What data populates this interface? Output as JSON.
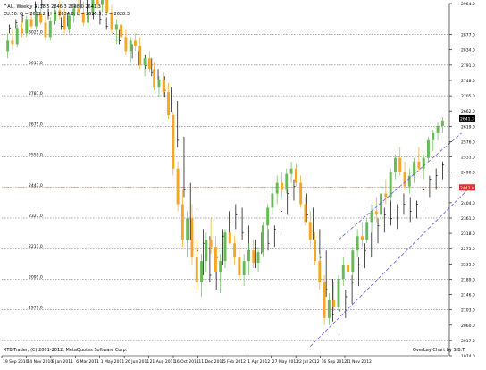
{
  "header": {
    "line1": "^AU, Weekly  3138.5 2846.3 2638.0 2641.3",
    "line2": "EU.50: O = 2632.2, H = 2634.8, L = 2625.3, C = 2628.3"
  },
  "footer": {
    "copyright": "XTB-Trader, (C) 2001-2012, MetaQuotes Software Corp.",
    "credit": "OverLay Chart by S.B.T."
  },
  "colors": {
    "background": "#ffffff",
    "bull_candle": "#66bb55",
    "bear_candle": "#f5a623",
    "overlay_bar": "#000000",
    "grid": "#555555",
    "trendline": "#4b4bd9",
    "current_price_marker": "#000000",
    "price_marker_red": "#e03030",
    "red_dotted_line": "#e06060"
  },
  "chart_data": {
    "type": "candlestick",
    "timeframe": "Weekly",
    "main_series": "^AU",
    "overlay_series": "EU.50",
    "right_axis_ticks": [
      "2964.0",
      "2877.0",
      "2834.0",
      "2791.0",
      "2748.0",
      "2705.0",
      "2662.0",
      "2619.0",
      "2576.0",
      "2533.0",
      "2490.0",
      "2447.0",
      "2404.0",
      "2361.0",
      "2318.0",
      "2275.0",
      "2232.0",
      "2189.0",
      "2146.0",
      "2103.0",
      "2060.0",
      "2017.0",
      "1974.0"
    ],
    "left_overlay_labels": [
      "3025.0",
      "2913.0",
      "2787.0",
      "2675.0",
      "2559.0",
      "2443.0",
      "2327.0",
      "2211.0",
      "2095.0",
      "1979.0"
    ],
    "x_labels": [
      "19 Sep 2010",
      "14 Nov 2010",
      "9 Jan 2011",
      "6 Mar 2011",
      "1 May 2011",
      "26 Jun 2011",
      "21 Aug 2011",
      "16 Oct 2011",
      "11 Dec 2011",
      "5 Feb 2012",
      "1 Apr 2012",
      "27 May 2012",
      "22 Jul 2012",
      "16 Sep 2012",
      "11 Nov 2012"
    ],
    "current_price": "2641.3",
    "red_price_marker": "2447.0",
    "ohlc": [
      {
        "o": 2830,
        "h": 2880,
        "l": 2810,
        "c": 2860
      },
      {
        "o": 2860,
        "h": 2890,
        "l": 2835,
        "c": 2850
      },
      {
        "o": 2850,
        "h": 2905,
        "l": 2840,
        "c": 2895
      },
      {
        "o": 2895,
        "h": 2915,
        "l": 2870,
        "c": 2880
      },
      {
        "o": 2880,
        "h": 2930,
        "l": 2870,
        "c": 2920
      },
      {
        "o": 2920,
        "h": 2940,
        "l": 2895,
        "c": 2900
      },
      {
        "o": 2900,
        "h": 2945,
        "l": 2890,
        "c": 2935
      },
      {
        "o": 2935,
        "h": 2950,
        "l": 2905,
        "c": 2910
      },
      {
        "o": 2910,
        "h": 2930,
        "l": 2860,
        "c": 2870
      },
      {
        "o": 2870,
        "h": 2925,
        "l": 2860,
        "c": 2915
      },
      {
        "o": 2915,
        "h": 2955,
        "l": 2905,
        "c": 2945
      },
      {
        "o": 2945,
        "h": 2970,
        "l": 2920,
        "c": 2930
      },
      {
        "o": 2930,
        "h": 2950,
        "l": 2880,
        "c": 2890
      },
      {
        "o": 2890,
        "h": 2940,
        "l": 2880,
        "c": 2930
      },
      {
        "o": 2930,
        "h": 2960,
        "l": 2910,
        "c": 2950
      },
      {
        "o": 2950,
        "h": 2980,
        "l": 2930,
        "c": 2940
      },
      {
        "o": 2940,
        "h": 2970,
        "l": 2900,
        "c": 2910
      },
      {
        "o": 2910,
        "h": 2950,
        "l": 2890,
        "c": 2940
      },
      {
        "o": 2940,
        "h": 2995,
        "l": 2930,
        "c": 2985
      },
      {
        "o": 2985,
        "h": 3000,
        "l": 2950,
        "c": 2960
      },
      {
        "o": 2960,
        "h": 2985,
        "l": 2940,
        "c": 2975
      },
      {
        "o": 2975,
        "h": 2990,
        "l": 2930,
        "c": 2940
      },
      {
        "o": 2940,
        "h": 2960,
        "l": 2880,
        "c": 2890
      },
      {
        "o": 2890,
        "h": 2920,
        "l": 2850,
        "c": 2905
      },
      {
        "o": 2905,
        "h": 2930,
        "l": 2860,
        "c": 2870
      },
      {
        "o": 2870,
        "h": 2890,
        "l": 2820,
        "c": 2830
      },
      {
        "o": 2830,
        "h": 2870,
        "l": 2800,
        "c": 2860
      },
      {
        "o": 2860,
        "h": 2880,
        "l": 2830,
        "c": 2845
      },
      {
        "o": 2845,
        "h": 2870,
        "l": 2780,
        "c": 2790
      },
      {
        "o": 2790,
        "h": 2820,
        "l": 2760,
        "c": 2810
      },
      {
        "o": 2810,
        "h": 2830,
        "l": 2770,
        "c": 2780
      },
      {
        "o": 2780,
        "h": 2800,
        "l": 2720,
        "c": 2730
      },
      {
        "o": 2730,
        "h": 2760,
        "l": 2700,
        "c": 2750
      },
      {
        "o": 2750,
        "h": 2770,
        "l": 2700,
        "c": 2715
      },
      {
        "o": 2715,
        "h": 2740,
        "l": 2640,
        "c": 2650
      },
      {
        "o": 2650,
        "h": 2660,
        "l": 2480,
        "c": 2500
      },
      {
        "o": 2500,
        "h": 2520,
        "l": 2380,
        "c": 2400
      },
      {
        "o": 2400,
        "h": 2440,
        "l": 2280,
        "c": 2300
      },
      {
        "o": 2300,
        "h": 2380,
        "l": 2250,
        "c": 2360
      },
      {
        "o": 2360,
        "h": 2400,
        "l": 2230,
        "c": 2250
      },
      {
        "o": 2250,
        "h": 2300,
        "l": 2160,
        "c": 2180
      },
      {
        "o": 2180,
        "h": 2260,
        "l": 2140,
        "c": 2240
      },
      {
        "o": 2240,
        "h": 2320,
        "l": 2210,
        "c": 2300
      },
      {
        "o": 2300,
        "h": 2360,
        "l": 2260,
        "c": 2280
      },
      {
        "o": 2280,
        "h": 2310,
        "l": 2190,
        "c": 2210
      },
      {
        "o": 2210,
        "h": 2260,
        "l": 2150,
        "c": 2240
      },
      {
        "o": 2240,
        "h": 2330,
        "l": 2220,
        "c": 2320
      },
      {
        "o": 2320,
        "h": 2360,
        "l": 2270,
        "c": 2290
      },
      {
        "o": 2290,
        "h": 2310,
        "l": 2230,
        "c": 2250
      },
      {
        "o": 2250,
        "h": 2280,
        "l": 2180,
        "c": 2200
      },
      {
        "o": 2200,
        "h": 2260,
        "l": 2170,
        "c": 2240
      },
      {
        "o": 2240,
        "h": 2290,
        "l": 2200,
        "c": 2270
      },
      {
        "o": 2270,
        "h": 2300,
        "l": 2220,
        "c": 2235
      },
      {
        "o": 2235,
        "h": 2280,
        "l": 2210,
        "c": 2265
      },
      {
        "o": 2265,
        "h": 2350,
        "l": 2250,
        "c": 2340
      },
      {
        "o": 2340,
        "h": 2400,
        "l": 2320,
        "c": 2390
      },
      {
        "o": 2390,
        "h": 2450,
        "l": 2370,
        "c": 2430
      },
      {
        "o": 2430,
        "h": 2480,
        "l": 2400,
        "c": 2460
      },
      {
        "o": 2460,
        "h": 2490,
        "l": 2420,
        "c": 2440
      },
      {
        "o": 2440,
        "h": 2500,
        "l": 2430,
        "c": 2485
      },
      {
        "o": 2485,
        "h": 2520,
        "l": 2460,
        "c": 2500
      },
      {
        "o": 2500,
        "h": 2515,
        "l": 2450,
        "c": 2460
      },
      {
        "o": 2460,
        "h": 2480,
        "l": 2390,
        "c": 2400
      },
      {
        "o": 2400,
        "h": 2420,
        "l": 2340,
        "c": 2350
      },
      {
        "o": 2350,
        "h": 2380,
        "l": 2280,
        "c": 2300
      },
      {
        "o": 2300,
        "h": 2320,
        "l": 2230,
        "c": 2240
      },
      {
        "o": 2240,
        "h": 2260,
        "l": 2160,
        "c": 2180
      },
      {
        "o": 2180,
        "h": 2200,
        "l": 2060,
        "c": 2080
      },
      {
        "o": 2080,
        "h": 2150,
        "l": 2060,
        "c": 2130
      },
      {
        "o": 2130,
        "h": 2180,
        "l": 2100,
        "c": 2110
      },
      {
        "o": 2110,
        "h": 2200,
        "l": 2100,
        "c": 2190
      },
      {
        "o": 2190,
        "h": 2250,
        "l": 2170,
        "c": 2230
      },
      {
        "o": 2230,
        "h": 2260,
        "l": 2190,
        "c": 2210
      },
      {
        "o": 2210,
        "h": 2280,
        "l": 2200,
        "c": 2270
      },
      {
        "o": 2270,
        "h": 2330,
        "l": 2250,
        "c": 2310
      },
      {
        "o": 2310,
        "h": 2350,
        "l": 2280,
        "c": 2300
      },
      {
        "o": 2300,
        "h": 2360,
        "l": 2290,
        "c": 2350
      },
      {
        "o": 2350,
        "h": 2400,
        "l": 2320,
        "c": 2380
      },
      {
        "o": 2380,
        "h": 2420,
        "l": 2350,
        "c": 2370
      },
      {
        "o": 2370,
        "h": 2440,
        "l": 2360,
        "c": 2430
      },
      {
        "o": 2430,
        "h": 2470,
        "l": 2400,
        "c": 2420
      },
      {
        "o": 2420,
        "h": 2500,
        "l": 2410,
        "c": 2490
      },
      {
        "o": 2490,
        "h": 2540,
        "l": 2470,
        "c": 2530
      },
      {
        "o": 2530,
        "h": 2560,
        "l": 2480,
        "c": 2490
      },
      {
        "o": 2490,
        "h": 2520,
        "l": 2440,
        "c": 2450
      },
      {
        "o": 2450,
        "h": 2500,
        "l": 2430,
        "c": 2480
      },
      {
        "o": 2480,
        "h": 2530,
        "l": 2460,
        "c": 2520
      },
      {
        "o": 2520,
        "h": 2560,
        "l": 2490,
        "c": 2500
      },
      {
        "o": 2500,
        "h": 2540,
        "l": 2470,
        "c": 2530
      },
      {
        "o": 2530,
        "h": 2590,
        "l": 2520,
        "c": 2580
      },
      {
        "o": 2580,
        "h": 2610,
        "l": 2550,
        "c": 2600
      },
      {
        "o": 2600,
        "h": 2630,
        "l": 2580,
        "c": 2620
      },
      {
        "o": 2620,
        "h": 2645,
        "l": 2600,
        "c": 2635
      }
    ],
    "overlay_bars": [
      {
        "h": 2905,
        "l": 2880,
        "c": 2895
      },
      {
        "h": 2920,
        "l": 2895,
        "c": 2910
      },
      {
        "h": 2935,
        "l": 2910,
        "c": 2930
      },
      {
        "h": 2960,
        "l": 2930,
        "c": 2950
      },
      {
        "h": 2970,
        "l": 2940,
        "c": 2955
      },
      {
        "h": 2975,
        "l": 2950,
        "c": 2960
      },
      {
        "h": 2950,
        "l": 2920,
        "c": 2930
      },
      {
        "h": 2940,
        "l": 2905,
        "c": 2915
      },
      {
        "h": 2925,
        "l": 2890,
        "c": 2900
      },
      {
        "h": 2935,
        "l": 2900,
        "c": 2925
      },
      {
        "h": 2965,
        "l": 2930,
        "c": 2955
      },
      {
        "h": 2985,
        "l": 2950,
        "c": 2975
      },
      {
        "h": 2980,
        "l": 2940,
        "c": 2950
      },
      {
        "h": 2955,
        "l": 2920,
        "c": 2935
      },
      {
        "h": 2945,
        "l": 2905,
        "c": 2920
      },
      {
        "h": 2925,
        "l": 2890,
        "c": 2900
      },
      {
        "h": 2905,
        "l": 2870,
        "c": 2880
      },
      {
        "h": 2890,
        "l": 2850,
        "c": 2860
      },
      {
        "h": 2870,
        "l": 2830,
        "c": 2840
      },
      {
        "h": 2850,
        "l": 2810,
        "c": 2820
      },
      {
        "h": 2830,
        "l": 2790,
        "c": 2800
      },
      {
        "h": 2820,
        "l": 2780,
        "c": 2790
      },
      {
        "h": 2810,
        "l": 2760,
        "c": 2770
      },
      {
        "h": 2780,
        "l": 2730,
        "c": 2740
      },
      {
        "h": 2760,
        "l": 2700,
        "c": 2720
      },
      {
        "h": 2730,
        "l": 2660,
        "c": 2680
      },
      {
        "h": 2690,
        "l": 2560,
        "c": 2580
      },
      {
        "h": 2590,
        "l": 2420,
        "c": 2440
      },
      {
        "h": 2460,
        "l": 2300,
        "c": 2330
      },
      {
        "h": 2380,
        "l": 2240,
        "c": 2270
      },
      {
        "h": 2330,
        "l": 2200,
        "c": 2290
      },
      {
        "h": 2310,
        "l": 2180,
        "c": 2200
      },
      {
        "h": 2280,
        "l": 2160,
        "c": 2250
      },
      {
        "h": 2330,
        "l": 2230,
        "c": 2310
      },
      {
        "h": 2380,
        "l": 2290,
        "c": 2350
      },
      {
        "h": 2400,
        "l": 2330,
        "c": 2370
      },
      {
        "h": 2390,
        "l": 2300,
        "c": 2320
      },
      {
        "h": 2340,
        "l": 2250,
        "c": 2270
      },
      {
        "h": 2300,
        "l": 2220,
        "c": 2280
      },
      {
        "h": 2320,
        "l": 2260,
        "c": 2300
      },
      {
        "h": 2330,
        "l": 2270,
        "c": 2290
      },
      {
        "h": 2340,
        "l": 2280,
        "c": 2330
      },
      {
        "h": 2390,
        "l": 2330,
        "c": 2380
      },
      {
        "h": 2440,
        "l": 2370,
        "c": 2430
      },
      {
        "h": 2470,
        "l": 2410,
        "c": 2450
      },
      {
        "h": 2460,
        "l": 2400,
        "c": 2420
      },
      {
        "h": 2430,
        "l": 2350,
        "c": 2370
      },
      {
        "h": 2390,
        "l": 2300,
        "c": 2320
      },
      {
        "h": 2330,
        "l": 2220,
        "c": 2250
      },
      {
        "h": 2270,
        "l": 2140,
        "c": 2160
      },
      {
        "h": 2190,
        "l": 2070,
        "c": 2090
      },
      {
        "h": 2130,
        "l": 2040,
        "c": 2100
      },
      {
        "h": 2160,
        "l": 2080,
        "c": 2140
      },
      {
        "h": 2200,
        "l": 2120,
        "c": 2180
      },
      {
        "h": 2250,
        "l": 2170,
        "c": 2230
      },
      {
        "h": 2290,
        "l": 2220,
        "c": 2270
      },
      {
        "h": 2320,
        "l": 2250,
        "c": 2300
      },
      {
        "h": 2360,
        "l": 2290,
        "c": 2340
      },
      {
        "h": 2390,
        "l": 2320,
        "c": 2370
      },
      {
        "h": 2410,
        "l": 2340,
        "c": 2360
      },
      {
        "h": 2400,
        "l": 2330,
        "c": 2390
      },
      {
        "h": 2430,
        "l": 2370,
        "c": 2400
      },
      {
        "h": 2420,
        "l": 2350,
        "c": 2380
      },
      {
        "h": 2410,
        "l": 2360,
        "c": 2400
      },
      {
        "h": 2450,
        "l": 2390,
        "c": 2440
      },
      {
        "h": 2480,
        "l": 2420,
        "c": 2470
      },
      {
        "h": 2500,
        "l": 2440,
        "c": 2480
      },
      {
        "h": 2520,
        "l": 2470,
        "c": 2510
      }
    ],
    "trend_channel": {
      "style": "dashed",
      "lower": [
        {
          "week": 64,
          "price": 2000
        },
        {
          "week": 98,
          "price": 2450
        }
      ],
      "upper": [
        {
          "week": 70,
          "price": 2300
        },
        {
          "week": 96,
          "price": 2600
        }
      ]
    }
  }
}
